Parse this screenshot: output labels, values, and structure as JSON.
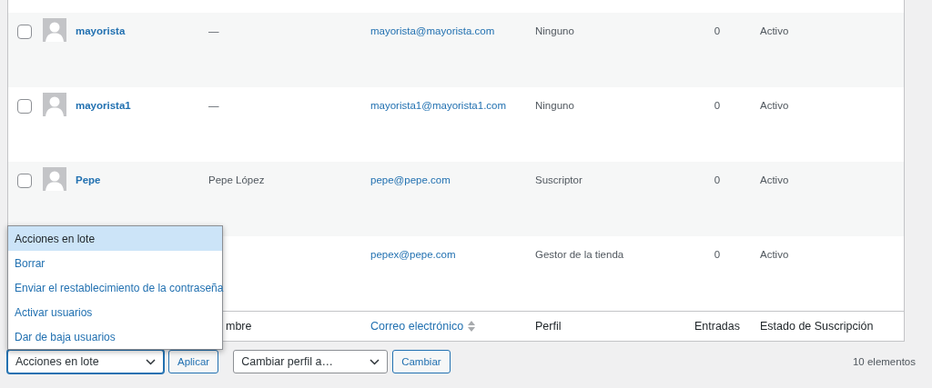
{
  "table": {
    "rows": [
      {
        "checked": false,
        "username": "mayorista",
        "name": "—",
        "email": "mayorista@mayorista.com",
        "role": "Ninguno",
        "posts": "0",
        "status": "Activo"
      },
      {
        "checked": false,
        "username": "mayorista1",
        "name": "—",
        "email": "mayorista1@mayorista1.com",
        "role": "Ninguno",
        "posts": "0",
        "status": "Activo"
      },
      {
        "checked": false,
        "username": "Pepe",
        "name": "Pepe López",
        "email": "pepe@pepe.com",
        "role": "Suscriptor",
        "posts": "0",
        "status": "Activo"
      },
      {
        "email": "pepex@pepe.com",
        "role": "Gestor de la tienda",
        "posts": "0",
        "status": "Activo"
      }
    ],
    "footer_columns": [
      {
        "label": "mbre",
        "kind": "plain"
      },
      {
        "label": "Correo electrónico",
        "kind": "sortable"
      },
      {
        "label": "Perfil",
        "kind": "plain"
      },
      {
        "label": "Entradas",
        "kind": "plain"
      },
      {
        "label": "Estado de Suscripción",
        "kind": "plain"
      }
    ]
  },
  "bulk_menu": {
    "options": [
      {
        "label": "Acciones en lote",
        "selected": true
      },
      {
        "label": "Borrar",
        "selected": false
      },
      {
        "label": "Enviar el restablecimiento de la contraseña",
        "selected": false
      },
      {
        "label": "Activar usuarios",
        "selected": false
      },
      {
        "label": "Dar de baja usuarios",
        "selected": false
      }
    ]
  },
  "toolbar": {
    "bulk_select": "Acciones en lote",
    "apply_button": "Aplicar",
    "role_select": "Cambiar perfil a…",
    "change_button": "Cambiar",
    "count": "10 elementos"
  }
}
